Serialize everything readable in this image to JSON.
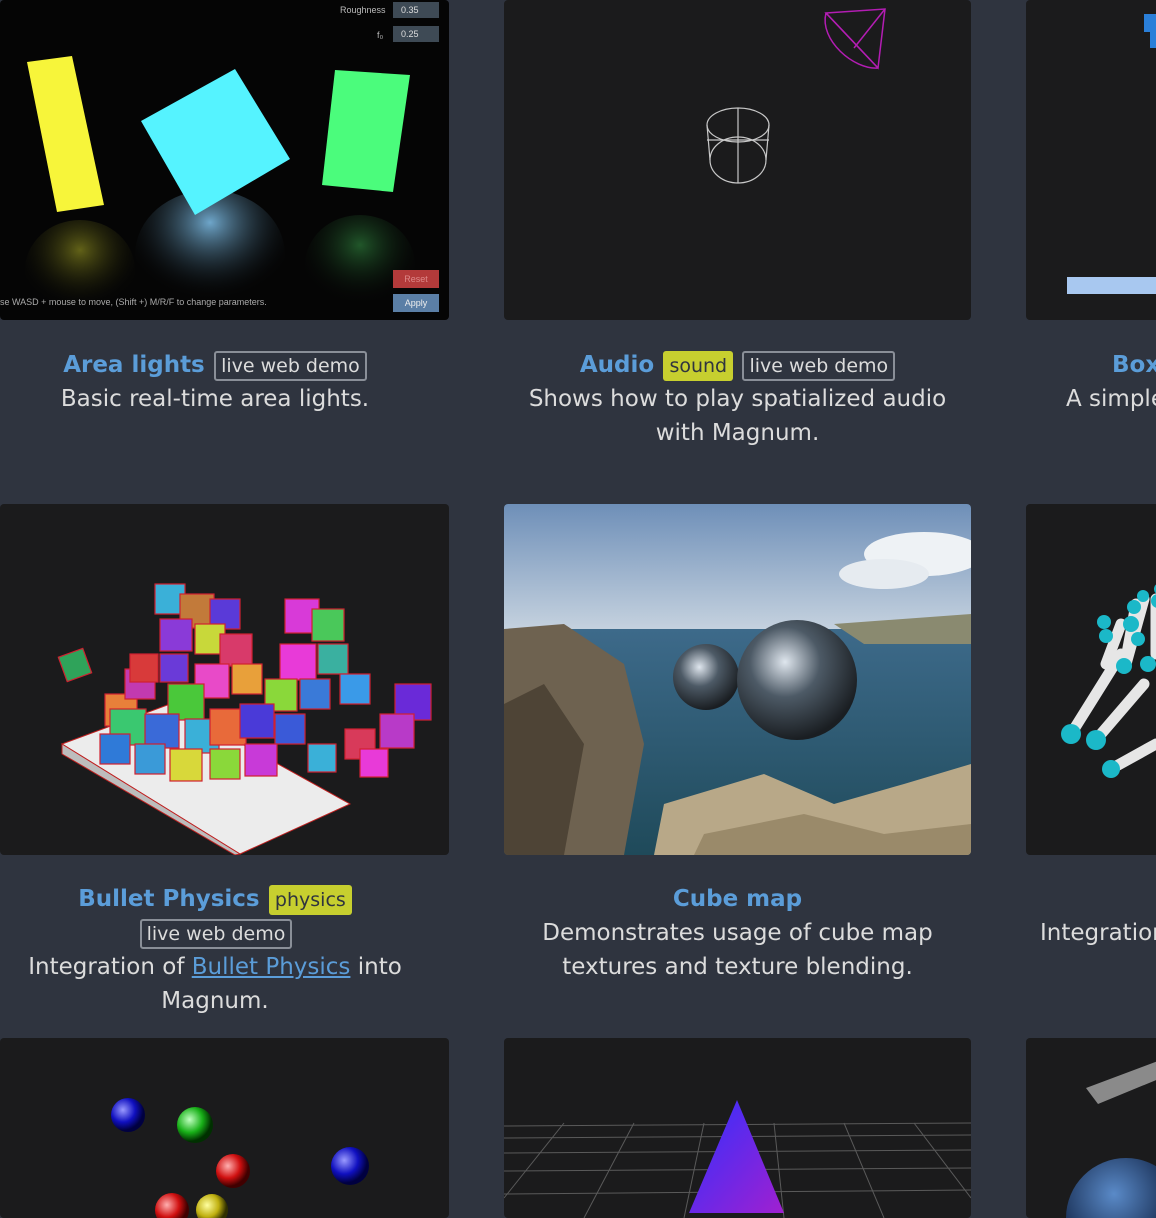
{
  "cards": {
    "area_lights": {
      "title": "Area lights",
      "demo_badge": "live web demo",
      "description": "Basic real-time area lights.",
      "ui": {
        "roughness_label": "Roughness",
        "roughness_value": "0.35",
        "f0_label": "f₀",
        "f0_value": "0.25",
        "reset_label": "Reset",
        "apply_label": "Apply",
        "hint": "se WASD + mouse to move, (Shift +) M/R/F to change parameters."
      }
    },
    "audio": {
      "title": "Audio",
      "tag_badge": "sound",
      "demo_badge": "live web demo",
      "description": "Shows how to play spatialized audio with Magnum."
    },
    "box2d": {
      "title": "Box",
      "description": "A simple"
    },
    "bullet": {
      "title": "Bullet Physics",
      "tag_badge": "physics",
      "demo_badge": "live web demo",
      "desc_prefix": "Integration of",
      "desc_link": "Bullet Physics",
      "desc_suffix": "into Magnum."
    },
    "cube_map": {
      "title": "Cube map",
      "description": "Demonstrates usage of cube map textures and texture blending."
    },
    "leap": {
      "description": "Integration"
    }
  },
  "colors": {
    "background": "#2f343f",
    "thumb_background": "#1b1b1c",
    "link": "#5b9dd9",
    "badge_tag": "#c7cf2f"
  }
}
